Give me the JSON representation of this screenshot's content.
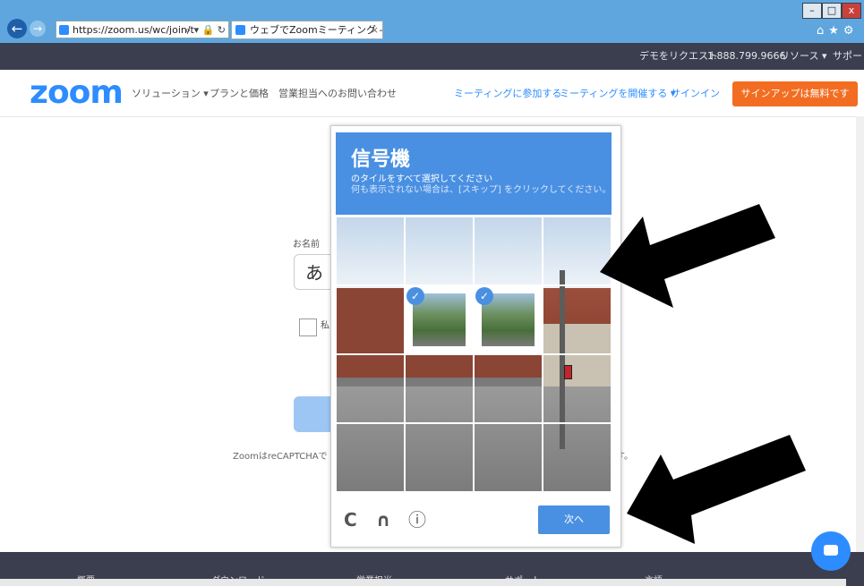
{
  "browser": {
    "url": "https://zoom.us/wc/join/t",
    "tab_title": "ウェブでZoomミーティング - Z...",
    "tab_close": "×",
    "back": "←",
    "forward": "→",
    "address_tools": "⌕ ▾ 🔒 ↻",
    "win_min": "–",
    "win_max": "□",
    "win_close": "x",
    "toolbar_icons": "⌂★⚙"
  },
  "topbar": {
    "demo": "デモをリクエスト",
    "phone": "1.888.799.9666",
    "resources": "リソース ▾",
    "support": "サポート"
  },
  "nav": {
    "logo": "zoom",
    "solutions": "ソリューション ▾",
    "plans": "プランと価格",
    "sales": "営業担当へのお問い合わせ",
    "join": "ミーティングに参加する",
    "host": "ミーティングを開催する ▾",
    "signin": "サインイン",
    "signup": "サインアップは無料です"
  },
  "form": {
    "name_label": "お名前",
    "name_value": "あ",
    "checkbox_label": "私",
    "recaptcha_note": "ZoomはreCAPTCHAで",
    "recaptcha_tail": "す。"
  },
  "footer": {
    "col1": "概要",
    "col2": "ダウンロード",
    "col3": "営業担当",
    "col4": "サポート",
    "col5": "言語"
  },
  "captcha": {
    "title": "信号機",
    "instruction": "のタイルをすべて選択してください",
    "hint": "何も表示されない場合は、[スキップ] をクリックしてください。",
    "check_mark": "✓",
    "reload_icon": "C",
    "audio_icon": "∩",
    "info_icon": "ⓘ",
    "next_label": "次へ",
    "selected_tiles": [
      5,
      6
    ]
  },
  "colors": {
    "zoom_blue": "#2d8cff",
    "captcha_blue": "#4a90e2",
    "signup_orange": "#f26d21"
  }
}
